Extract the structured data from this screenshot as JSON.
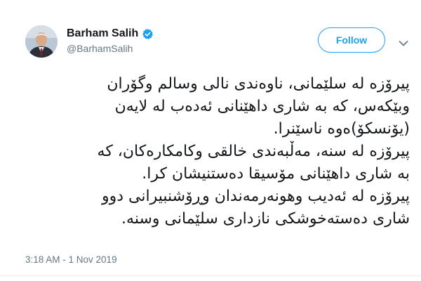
{
  "profile": {
    "display_name": "Barham Salih",
    "handle": "@BarhamSalih",
    "verified": true,
    "avatar_icon": "profile-photo"
  },
  "follow_button": {
    "label": "Follow"
  },
  "menu": {
    "icon": "chevron-down-icon"
  },
  "tweet": {
    "lines": [
      "پیرۆزە لە سلێمانی، ناوەندی نالی وسالم وگۆران",
      "وبێکەس، کە بە شاری داهێنانی ئەدەب لە لایەن",
      "(یۆنسکۆ)ەوە ناسێنرا.",
      "پیرۆزە لە سنە، مەڵبەندی خالقی وکامکارەکان، کە",
      "بە شاری داهێنانی مۆسیقا دەستنیشان کرا.",
      "پیرۆزە لە ئەدیب وهونەرمەندان وڕۆشنبیرانی دوو",
      "شاری دەستەخوشکی نازداری سلێمانی وسنە."
    ]
  },
  "timestamp": "3:18 AM - 1 Nov 2019",
  "colors": {
    "accent": "#1da1f2",
    "text": "#14171a",
    "muted": "#657786"
  }
}
